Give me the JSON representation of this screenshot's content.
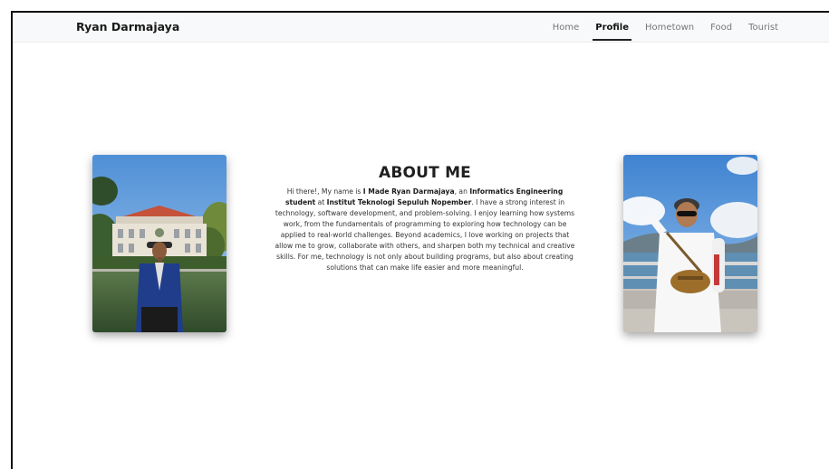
{
  "navbar": {
    "brand": "Ryan Darmajaya",
    "links": [
      {
        "label": "Home",
        "active": false
      },
      {
        "label": "Profile",
        "active": true
      },
      {
        "label": "Hometown",
        "active": false
      },
      {
        "label": "Food",
        "active": false
      },
      {
        "label": "Tourist",
        "active": false
      }
    ]
  },
  "about": {
    "title": "ABOUT ME",
    "p0": "Hi there!, My name is ",
    "name": "I Made Ryan Darmajaya",
    "p1": ", an ",
    "major": "Informatics Engineering student",
    "p2": " at ",
    "school": "Institut Teknologi Sepuluh Nopember",
    "p3": ". I have a strong interest in technology, software development, and problem-solving. I enjoy learning how systems work, from the fundamentals of programming to exploring how technology can be applied to real-world challenges. Beyond academics, I love working on projects that allow me to grow, collaborate with others, and sharpen both my technical and creative skills. For me, technology is not only about building programs, but also about creating solutions that can make life easier and more meaningful."
  },
  "colors": {
    "navbar_bg": "#f8f9fa",
    "text": "#222222",
    "sky": "#6fa6dc"
  }
}
